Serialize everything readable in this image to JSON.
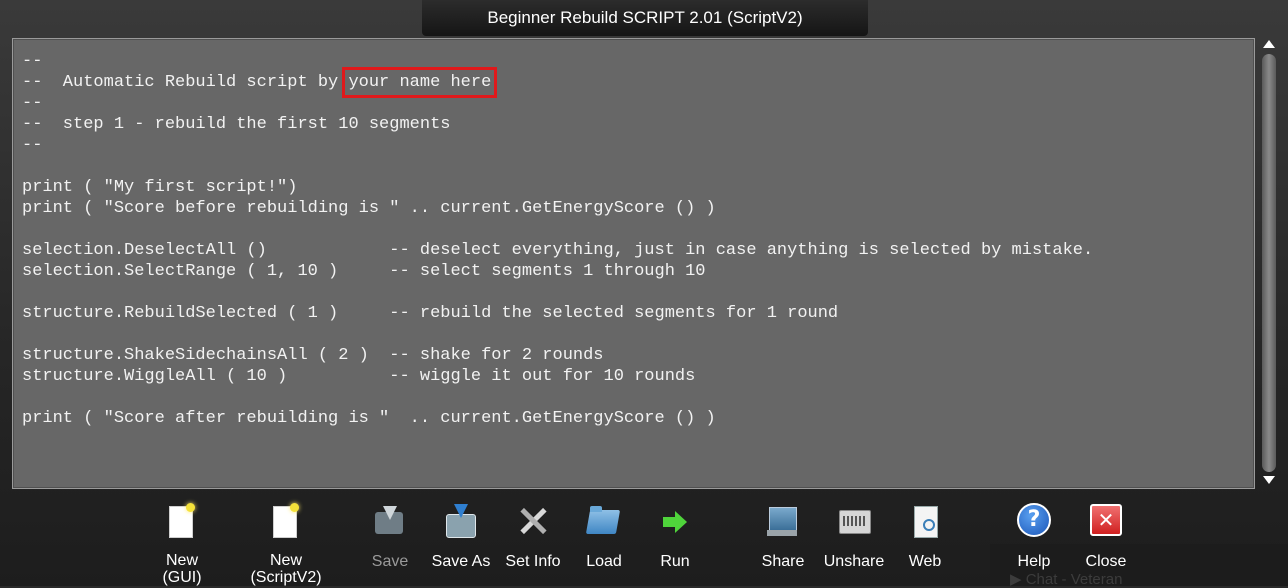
{
  "window": {
    "title": "Beginner Rebuild SCRIPT 2.01 (ScriptV2)"
  },
  "editor": {
    "lines": [
      "--",
      "--  Automatic Rebuild script by ",
      "--",
      "--  step 1 - rebuild the first 10 segments",
      "--",
      "",
      "print ( \"My first script!\")",
      "print ( \"Score before rebuilding is \" .. current.GetEnergyScore () )",
      "",
      "selection.DeselectAll ()            -- deselect everything, just in case anything is selected by mistake.",
      "selection.SelectRange ( 1, 10 )     -- select segments 1 through 10",
      "",
      "structure.RebuildSelected ( 1 )     -- rebuild the selected segments for 1 round",
      "",
      "structure.ShakeSidechainsAll ( 2 )  -- shake for 2 rounds",
      "structure.WiggleAll ( 10 )          -- wiggle it out for 10 rounds",
      "",
      "print ( \"Score after rebuilding is \"  .. current.GetEnergyScore () )"
    ],
    "highlighted_text": "your name here",
    "highlight_color": "#e0191b"
  },
  "toolbar": {
    "buttons": [
      {
        "id": "new-gui",
        "label": "New\n(GUI)",
        "icon": "new-page-icon",
        "enabled": true
      },
      {
        "id": "new-scriptv2",
        "label": "New\n(ScriptV2)",
        "icon": "new-page-icon",
        "enabled": true
      },
      {
        "id": "save",
        "label": "Save",
        "icon": "save-icon",
        "enabled": false
      },
      {
        "id": "save-as",
        "label": "Save As",
        "icon": "save-as-icon",
        "enabled": true
      },
      {
        "id": "set-info",
        "label": "Set Info",
        "icon": "tools-icon",
        "enabled": true
      },
      {
        "id": "load",
        "label": "Load",
        "icon": "folder-icon",
        "enabled": true
      },
      {
        "id": "run",
        "label": "Run",
        "icon": "run-arrow-icon",
        "enabled": true
      },
      {
        "id": "share",
        "label": "Share",
        "icon": "share-icon",
        "enabled": true
      },
      {
        "id": "unshare",
        "label": "Unshare",
        "icon": "unshare-icon",
        "enabled": true
      },
      {
        "id": "web",
        "label": "Web",
        "icon": "web-page-icon",
        "enabled": true
      },
      {
        "id": "help",
        "label": "Help",
        "icon": "help-icon",
        "enabled": true
      },
      {
        "id": "close",
        "label": "Close",
        "icon": "close-icon",
        "enabled": true
      }
    ]
  },
  "background": {
    "chat_label": "▶ Chat - Veteran"
  }
}
